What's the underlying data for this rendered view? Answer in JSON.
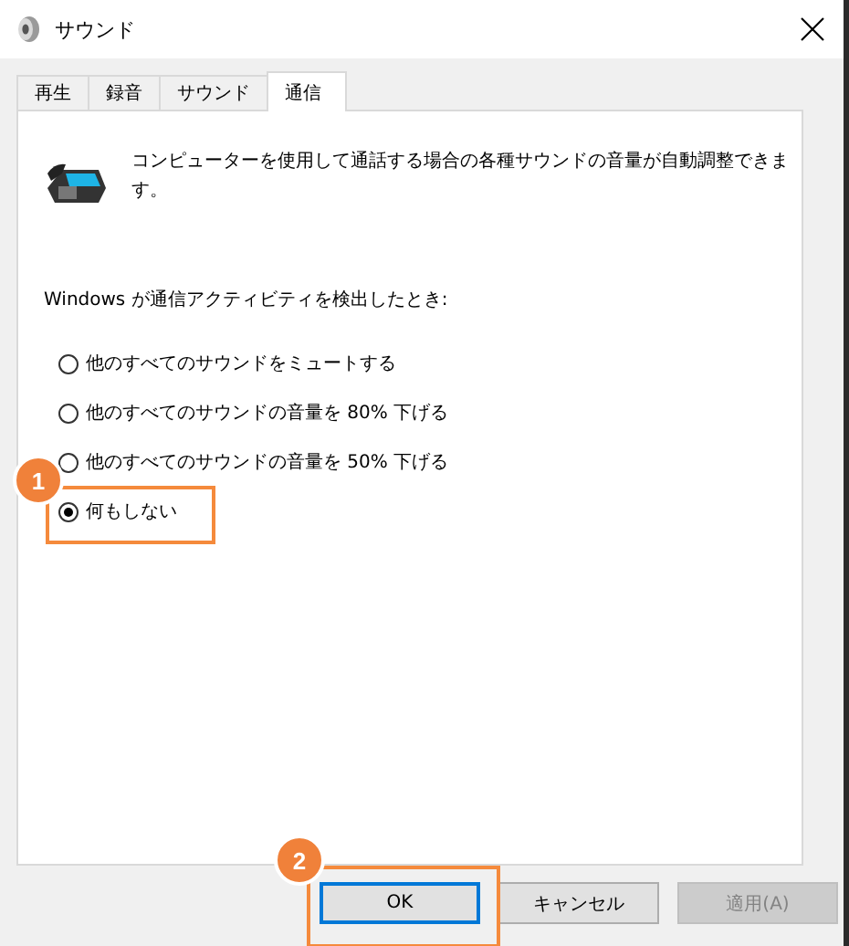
{
  "window": {
    "title": "サウンド"
  },
  "tabs": [
    {
      "label": "再生",
      "selected": false
    },
    {
      "label": "録音",
      "selected": false
    },
    {
      "label": "サウンド",
      "selected": false
    },
    {
      "label": "通信",
      "selected": true
    }
  ],
  "description": "コンピューターを使用して通話する場合の各種サウンドの音量が自動調整できます。",
  "prompt": "Windows が通信アクティビティを検出したとき:",
  "options": [
    {
      "label": "他のすべてのサウンドをミュートする",
      "selected": false
    },
    {
      "label": "他のすべてのサウンドの音量を 80% 下げる",
      "selected": false
    },
    {
      "label": "他のすべてのサウンドの音量を 50% 下げる",
      "selected": false
    },
    {
      "label": "何もしない",
      "selected": true,
      "callout": "1"
    }
  ],
  "buttons": [
    {
      "label": "OK",
      "focused": true,
      "disabled": false,
      "callout": "2"
    },
    {
      "label": "キャンセル",
      "focused": false,
      "disabled": false
    },
    {
      "label": "適用(A)",
      "focused": false,
      "disabled": true
    }
  ]
}
